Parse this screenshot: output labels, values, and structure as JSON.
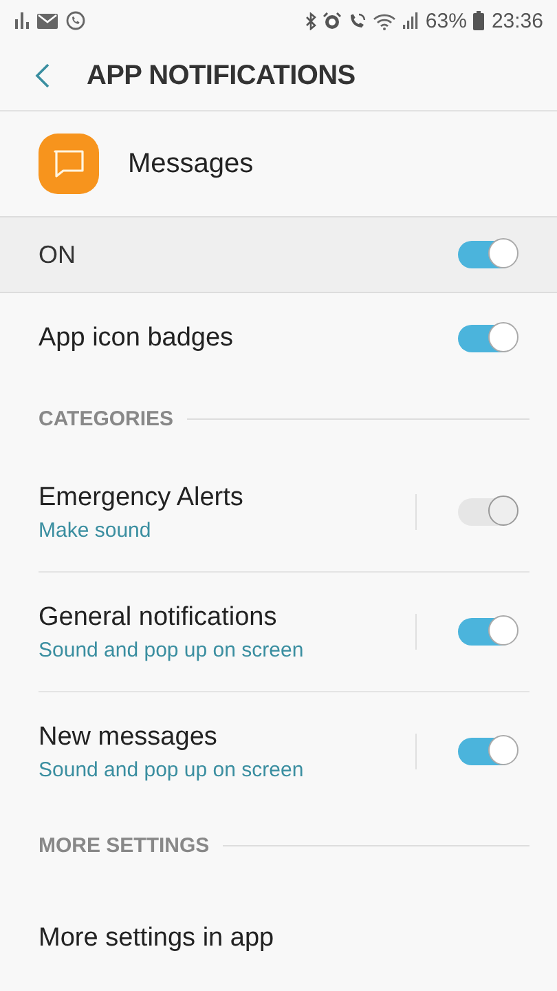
{
  "status_bar": {
    "battery": "63%",
    "time": "23:36"
  },
  "header": {
    "title": "APP NOTIFICATIONS"
  },
  "app": {
    "name": "Messages"
  },
  "master": {
    "label": "ON",
    "on": true
  },
  "badges": {
    "label": "App icon badges",
    "on": true
  },
  "sections": [
    {
      "title": "CATEGORIES",
      "items": [
        {
          "kind": "toggle",
          "label": "Emergency Alerts",
          "subtitle": "Make sound",
          "on": true,
          "disabled": true
        },
        {
          "kind": "toggle",
          "label": "General notifications",
          "subtitle": "Sound and pop up on screen",
          "on": true,
          "disabled": false
        },
        {
          "kind": "toggle",
          "label": "New messages",
          "subtitle": "Sound and pop up on screen",
          "on": true,
          "disabled": false
        }
      ]
    },
    {
      "title": "MORE SETTINGS",
      "items": [
        {
          "kind": "link",
          "label": "More settings in app"
        }
      ]
    }
  ]
}
